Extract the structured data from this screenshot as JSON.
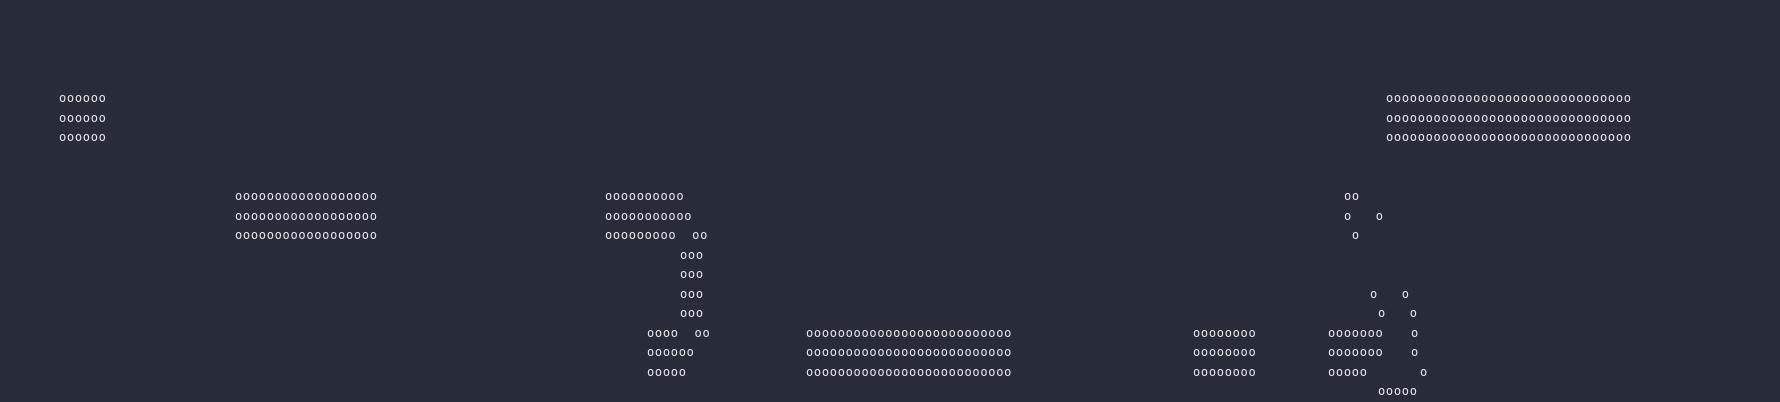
{
  "art": {
    "g1": [
      "oooooo",
      "oooooo",
      "oooooo"
    ],
    "g2": [
      "ooooooooooooooooooooooooooooooo",
      "ooooooooooooooooooooooooooooooo",
      "ooooooooooooooooooooooooooooooo"
    ],
    "g3": [
      "oooooooooooooooooo",
      "oooooooooooooooooo",
      "oooooooooooooooooo"
    ],
    "g4": [
      "oooooooooo",
      "ooooooooooo",
      "ooooooooo  oo",
      "ooo",
      "ooo",
      "ooo",
      "ooo",
      "oooo  oo",
      "oooooo",
      "ooooo"
    ],
    "g5": [
      "oooooooooooooooooooooooooo",
      "oooooooooooooooooooooooooo",
      "oooooooooooooooooooooooooo"
    ],
    "g6": [
      "oooooooo",
      "oooooooo",
      "oooooooo"
    ],
    "g7": [
      "ooooooo",
      "ooooooo",
      "ooooo"
    ],
    "g8": [
      "oo",
      "o   o",
      " o",
      "o   o",
      "o   o",
      "o",
      "o",
      "o",
      "ooooo"
    ]
  }
}
